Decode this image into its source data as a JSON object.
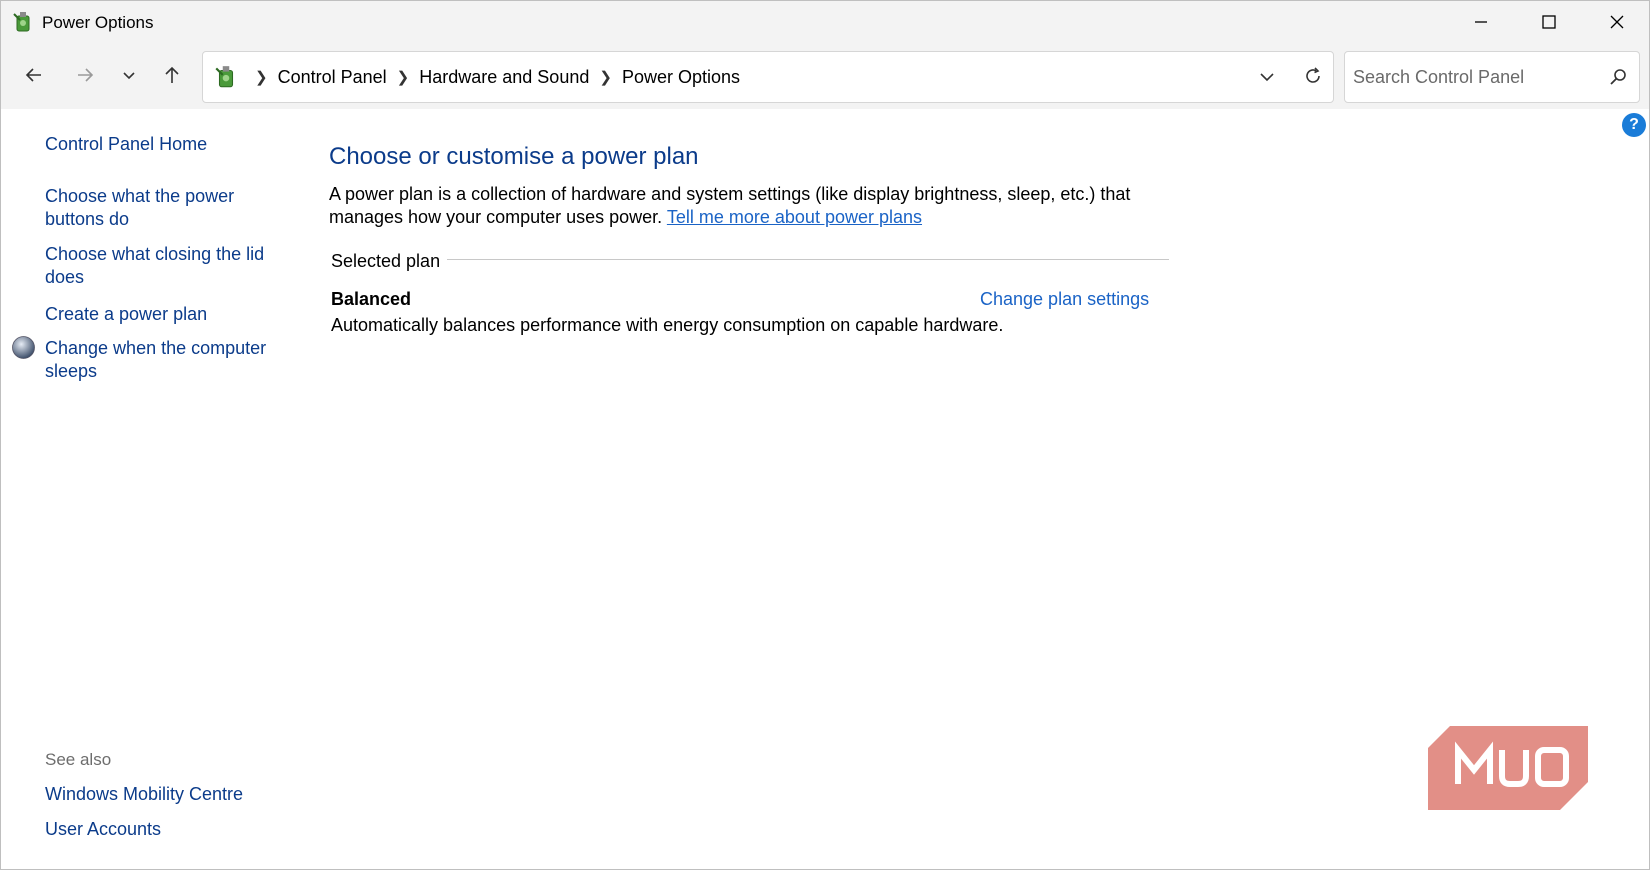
{
  "window": {
    "title": "Power Options",
    "controls": {
      "minimize": "minimize-icon",
      "maximize": "maximize-icon",
      "close": "close-icon"
    }
  },
  "navigation": {
    "breadcrumbs": [
      "Control Panel",
      "Hardware and Sound",
      "Power Options"
    ],
    "search_placeholder": "Search Control Panel"
  },
  "sidebar": {
    "home": "Control Panel Home",
    "links": [
      "Choose what the power buttons do",
      "Choose what closing the lid does",
      "Create a power plan",
      "Change when the computer sleeps"
    ],
    "see_also_label": "See also",
    "see_also": [
      "Windows Mobility Centre",
      "User Accounts"
    ]
  },
  "main": {
    "title": "Choose or customise a power plan",
    "description": "A power plan is a collection of hardware and system settings (like display brightness, sleep, etc.) that manages how your computer uses power.",
    "learn_more": "Tell me more about power plans",
    "section_label": "Selected plan",
    "plan": {
      "name": "Balanced",
      "settings_link": "Change plan settings",
      "description": "Automatically balances performance with energy consumption on capable hardware."
    }
  },
  "help": "?",
  "watermark": "MUO",
  "colors": {
    "link": "#0b3b8a",
    "accent_link": "#1a63c6",
    "help": "#1a7cd8",
    "logo": "#e28f87"
  }
}
